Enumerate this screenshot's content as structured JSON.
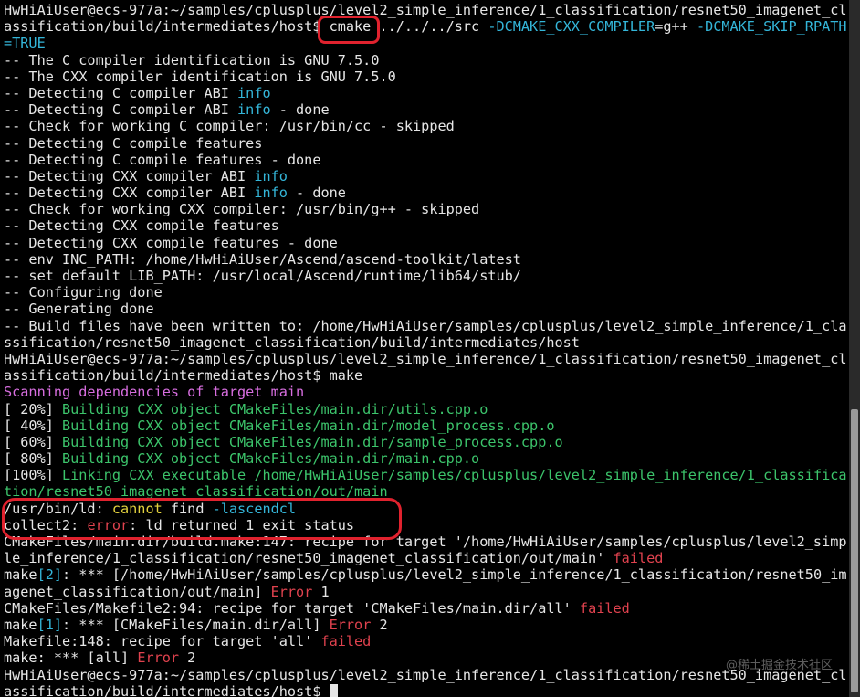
{
  "terminal": {
    "lines": [
      [
        {
          "t": "HwHiAiUser@ecs-977a:~/samples/cplusplus/level2_simple_inference/1_classification/resnet50_imagenet_cl",
          "c": "default"
        }
      ],
      [
        {
          "t": "assification/build/intermediates/host$ ",
          "c": "default"
        },
        {
          "t": "cmake",
          "c": "default"
        },
        {
          "t": " ../../../src ",
          "c": "default"
        },
        {
          "t": "-DCMAKE_CXX_COMPILER",
          "c": "cyan"
        },
        {
          "t": "=g++ ",
          "c": "default"
        },
        {
          "t": "-DCMAKE_SKIP_RPATH",
          "c": "cyan"
        }
      ],
      [
        {
          "t": "=TRUE",
          "c": "cyan"
        }
      ],
      [
        {
          "t": "-- The C compiler identification is GNU 7.5.0",
          "c": "default"
        }
      ],
      [
        {
          "t": "-- The CXX compiler identification is GNU 7.5.0",
          "c": "default"
        }
      ],
      [
        {
          "t": "-- Detecting C compiler ABI ",
          "c": "default"
        },
        {
          "t": "info",
          "c": "cyan"
        }
      ],
      [
        {
          "t": "-- Detecting C compiler ABI ",
          "c": "default"
        },
        {
          "t": "info",
          "c": "cyan"
        },
        {
          "t": " - done",
          "c": "default"
        }
      ],
      [
        {
          "t": "-- Check for working C compiler: /usr/bin/cc - skipped",
          "c": "default"
        }
      ],
      [
        {
          "t": "-- Detecting C compile features",
          "c": "default"
        }
      ],
      [
        {
          "t": "-- Detecting C compile features - done",
          "c": "default"
        }
      ],
      [
        {
          "t": "-- Detecting CXX compiler ABI ",
          "c": "default"
        },
        {
          "t": "info",
          "c": "cyan"
        }
      ],
      [
        {
          "t": "-- Detecting CXX compiler ABI ",
          "c": "default"
        },
        {
          "t": "info",
          "c": "cyan"
        },
        {
          "t": " - done",
          "c": "default"
        }
      ],
      [
        {
          "t": "-- Check for working CXX compiler: /usr/bin/g++ - skipped",
          "c": "default"
        }
      ],
      [
        {
          "t": "-- Detecting CXX compile features",
          "c": "default"
        }
      ],
      [
        {
          "t": "-- Detecting CXX compile features - done",
          "c": "default"
        }
      ],
      [
        {
          "t": "-- env INC_PATH: /home/HwHiAiUser/Ascend/ascend-toolkit/latest",
          "c": "default"
        }
      ],
      [
        {
          "t": "-- set default LIB_PATH: /usr/local/Ascend/runtime/lib64/stub/",
          "c": "default"
        }
      ],
      [
        {
          "t": "-- Configuring done",
          "c": "default"
        }
      ],
      [
        {
          "t": "-- Generating done",
          "c": "default"
        }
      ],
      [
        {
          "t": "-- Build files have been written to: /home/HwHiAiUser/samples/cplusplus/level2_simple_inference/1_cla",
          "c": "default"
        }
      ],
      [
        {
          "t": "ssification/resnet50_imagenet_classification/build/intermediates/host",
          "c": "default"
        }
      ],
      [
        {
          "t": "HwHiAiUser@ecs-977a:~/samples/cplusplus/level2_simple_inference/1_classification/resnet50_imagenet_cl",
          "c": "default"
        }
      ],
      [
        {
          "t": "assification/build/intermediates/host$ make",
          "c": "default"
        }
      ],
      [
        {
          "t": "Scanning dependencies of target main",
          "c": "magenta"
        }
      ],
      [
        {
          "t": "[ 20%] ",
          "c": "default"
        },
        {
          "t": "Building CXX object CMakeFiles/main.dir/utils.cpp.o",
          "c": "green"
        }
      ],
      [
        {
          "t": "[ 40%] ",
          "c": "default"
        },
        {
          "t": "Building CXX object CMakeFiles/main.dir/model_process.cpp.o",
          "c": "green"
        }
      ],
      [
        {
          "t": "[ 60%] ",
          "c": "default"
        },
        {
          "t": "Building CXX object CMakeFiles/main.dir/sample_process.cpp.o",
          "c": "green"
        }
      ],
      [
        {
          "t": "[ 80%] ",
          "c": "default"
        },
        {
          "t": "Building CXX object CMakeFiles/main.dir/main.cpp.o",
          "c": "green"
        }
      ],
      [
        {
          "t": "[100%] ",
          "c": "default"
        },
        {
          "t": "Linking CXX executable /home/HwHiAiUser/samples/cplusplus/level2_simple_inference/1_classifica",
          "c": "green"
        }
      ],
      [
        {
          "t": "tion/resnet50_imagenet_classification/out/main",
          "c": "green"
        }
      ],
      [
        {
          "t": "/usr/bin/ld: ",
          "c": "default"
        },
        {
          "t": "cannot",
          "c": "yellow"
        },
        {
          "t": " find ",
          "c": "default"
        },
        {
          "t": "-lascendcl",
          "c": "cyan"
        }
      ],
      [
        {
          "t": "collect2: ",
          "c": "default"
        },
        {
          "t": "error",
          "c": "red"
        },
        {
          "t": ": ld returned 1 exit status",
          "c": "default"
        }
      ],
      [
        {
          "t": "CMakeFiles/main.dir/build.make:147: recipe for target '/home/HwHiAiUser/samples/cplusplus/level2_simp",
          "c": "default"
        }
      ],
      [
        {
          "t": "le_inference/1_classification/resnet50_imagenet_classification/out/main' ",
          "c": "default"
        },
        {
          "t": "failed",
          "c": "red"
        }
      ],
      [
        {
          "t": "make",
          "c": "default"
        },
        {
          "t": "[2]",
          "c": "cyan"
        },
        {
          "t": ": *** [/home/HwHiAiUser/samples/cplusplus/level2_simple_inference/1_classification/resnet50_im",
          "c": "default"
        }
      ],
      [
        {
          "t": "agenet_classification/out/main] ",
          "c": "default"
        },
        {
          "t": "Error",
          "c": "red"
        },
        {
          "t": " 1",
          "c": "default"
        }
      ],
      [
        {
          "t": "CMakeFiles/Makefile2:94: recipe for target 'CMakeFiles/main.dir/all' ",
          "c": "default"
        },
        {
          "t": "failed",
          "c": "red"
        }
      ],
      [
        {
          "t": "make",
          "c": "default"
        },
        {
          "t": "[1]",
          "c": "cyan"
        },
        {
          "t": ": *** [CMakeFiles/main.dir/all] ",
          "c": "default"
        },
        {
          "t": "Error",
          "c": "red"
        },
        {
          "t": " 2",
          "c": "default"
        }
      ],
      [
        {
          "t": "Makefile:148: recipe for target 'all' ",
          "c": "default"
        },
        {
          "t": "failed",
          "c": "red"
        }
      ],
      [
        {
          "t": "make: *** [all] ",
          "c": "default"
        },
        {
          "t": "Error",
          "c": "red"
        },
        {
          "t": " 2",
          "c": "default"
        }
      ],
      [
        {
          "t": "HwHiAiUser@ecs-977a:~/samples/cplusplus/level2_simple_inference/1_classification/resnet50_imagenet_cl",
          "c": "default"
        }
      ],
      [
        {
          "t": "assification/build/intermediates/host$ ",
          "c": "default"
        },
        {
          "t": "",
          "c": "cursor"
        }
      ]
    ]
  },
  "watermark": {
    "text": "@稀土掘金技术社区"
  },
  "colors": {
    "background": "#000000",
    "default": "#e6e6e6",
    "cyan": "#34b6d9",
    "magenta": "#d86ee0",
    "green": "#3cc46b",
    "red": "#e0424e",
    "yellow": "#e3d23e",
    "annotation": "#e0222e"
  }
}
